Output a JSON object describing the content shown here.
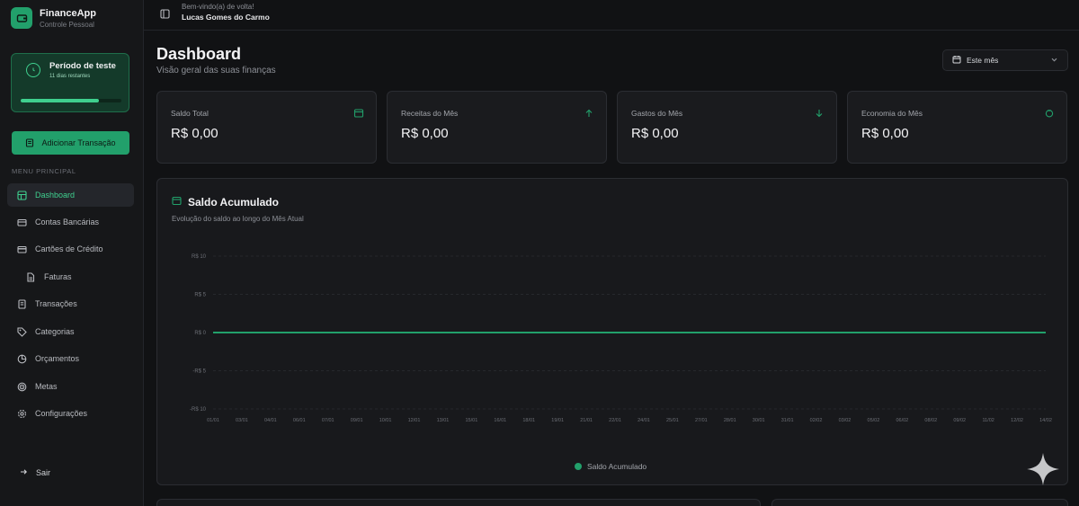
{
  "app": {
    "name": "FinanceApp",
    "subtitle": "Controle Pessoal"
  },
  "trial": {
    "title": "Período de teste",
    "date": "11 dias restantes",
    "progress": 0.78
  },
  "sidebar": {
    "add_button": "Adicionar Transação",
    "menu_label": "MENU PRINCIPAL",
    "items": [
      {
        "label": "Dashboard",
        "icon": "grid-icon"
      },
      {
        "label": "Contas Bancárias",
        "icon": "bank-icon"
      },
      {
        "label": "Cartões de Crédito",
        "icon": "credit-card-icon"
      },
      {
        "label": "Faturas",
        "icon": "document-icon"
      },
      {
        "label": "Transações",
        "icon": "receipt-icon"
      },
      {
        "label": "Categorias",
        "icon": "tag-icon"
      },
      {
        "label": "Orçamentos",
        "icon": "pie-icon"
      },
      {
        "label": "Metas",
        "icon": "target-icon"
      },
      {
        "label": "Configurações",
        "icon": "gear-icon"
      }
    ],
    "logout": "Sair"
  },
  "topbar": {
    "welcome": "Bem-vindo(a) de volta!",
    "user": "Lucas Gomes do Carmo"
  },
  "header": {
    "title": "Dashboard",
    "subtitle": "Visão geral das suas finanças",
    "period": "Este mês"
  },
  "cards": [
    {
      "label": "Saldo Total",
      "value": "R$ 0,00",
      "icon": "wallet-icon"
    },
    {
      "label": "Receitas do Mês",
      "value": "R$ 0,00",
      "icon": "arrow-up-icon"
    },
    {
      "label": "Gastos do Mês",
      "value": "R$ 0,00",
      "icon": "arrow-down-icon"
    },
    {
      "label": "Economia do Mês",
      "value": "R$ 0,00",
      "icon": "piggy-bank-icon"
    }
  ],
  "chart": {
    "title": "Saldo Acumulado",
    "subtitle": "Evolução do saldo ao longo do Mês Atual"
  },
  "colors": {
    "accent": "#22a06b",
    "bg": "#111214",
    "card": "#1a1b1e"
  },
  "chart_data": {
    "type": "line",
    "title": "Saldo Acumulado",
    "y_ticks": [
      "R$ 10",
      "R$ 5",
      "R$ 0",
      "-R$ 5",
      "-R$ 10"
    ],
    "ylim": [
      -10,
      10
    ],
    "x": [
      "01/01",
      "03/01",
      "04/01",
      "06/01",
      "07/01",
      "09/01",
      "10/01",
      "12/01",
      "13/01",
      "15/01",
      "16/01",
      "18/01",
      "19/01",
      "21/01",
      "22/01",
      "24/01",
      "25/01",
      "27/01",
      "28/01",
      "30/01",
      "31/01",
      "02/02",
      "03/02",
      "05/02",
      "06/02",
      "08/02",
      "09/02",
      "11/02",
      "12/02",
      "14/02"
    ],
    "series": [
      {
        "name": "Saldo Acumulado",
        "values": [
          0,
          0,
          0,
          0,
          0,
          0,
          0,
          0,
          0,
          0,
          0,
          0,
          0,
          0,
          0,
          0,
          0,
          0,
          0,
          0,
          0,
          0,
          0,
          0,
          0,
          0,
          0,
          0,
          0,
          0
        ]
      }
    ],
    "grid": true,
    "legend": "bottom-center"
  }
}
